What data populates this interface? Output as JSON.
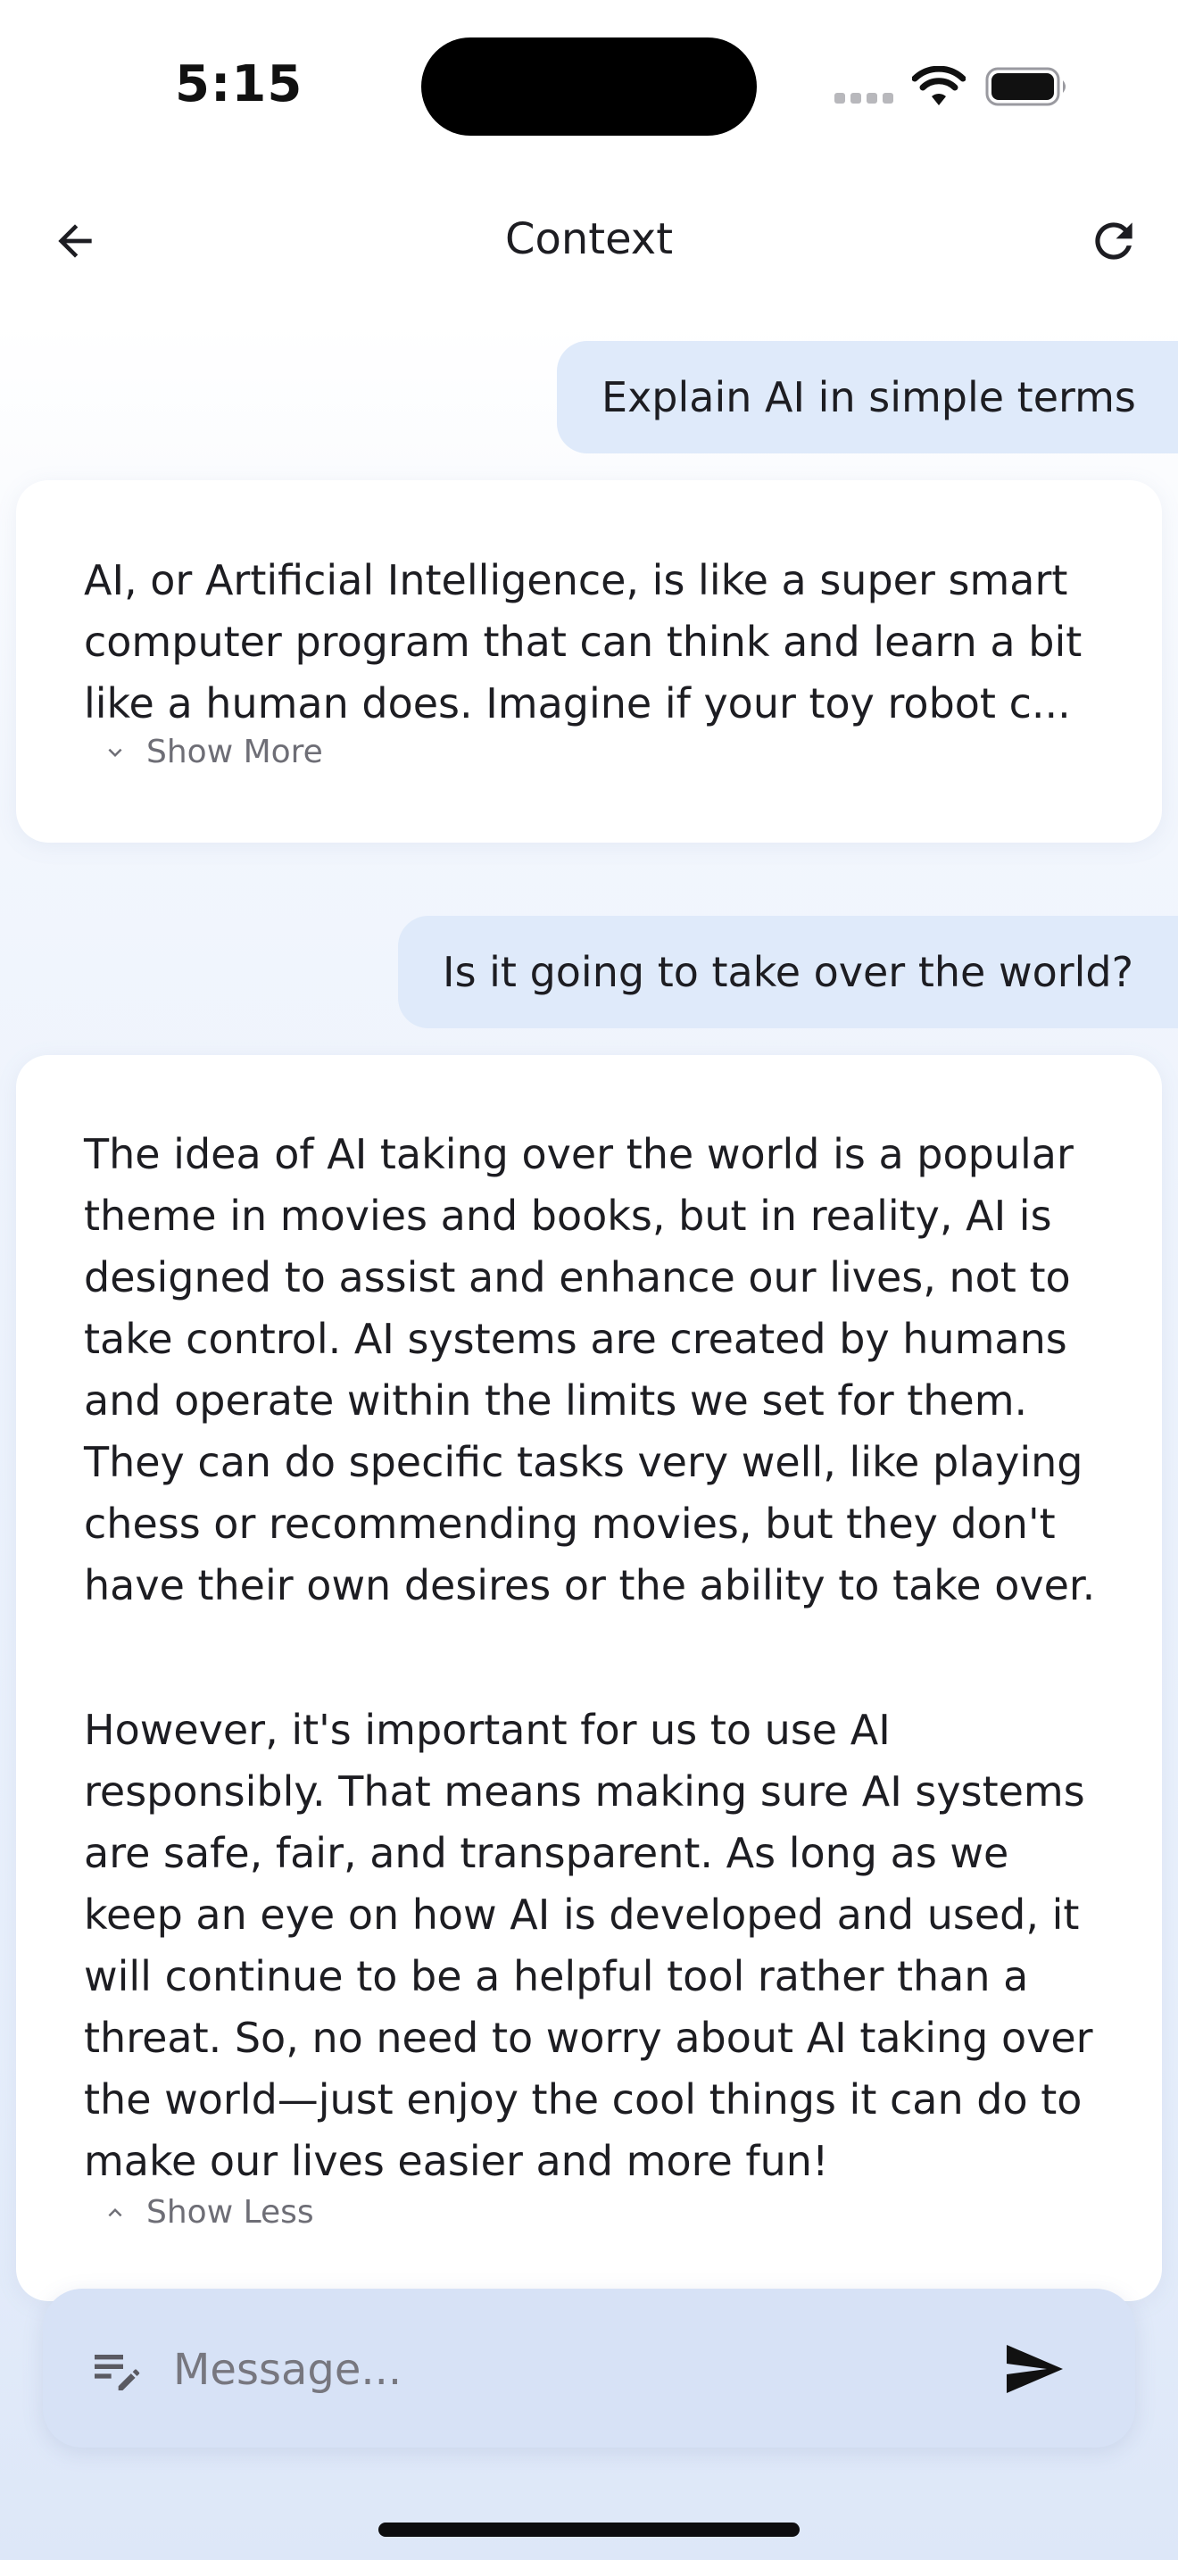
{
  "status_bar": {
    "time": "5:15",
    "icons": [
      "signal-icon",
      "wifi-icon",
      "battery-icon"
    ]
  },
  "header": {
    "title": "Context",
    "back_icon": "arrow-left-icon",
    "refresh_icon": "refresh-icon"
  },
  "messages": [
    {
      "role": "user",
      "text": "Explain AI in simple terms"
    },
    {
      "role": "assistant",
      "text": "AI, or Artificial Intelligence, is like a super smart computer program that can think and learn a bit like a human does. Imagine if your toy robot c...",
      "toggle_label": "Show More",
      "toggle_icon": "chevron-down-icon"
    },
    {
      "role": "user",
      "text": "Is it going to take over the world?"
    },
    {
      "role": "assistant",
      "paragraphs": [
        "The idea of AI taking over the world is a popular theme in movies and books, but in reality, AI is designed to assist and enhance our lives, not to take control. AI systems are created by humans and operate within the limits we set for them. They can do specific tasks very well, like playing chess or recommending movies, but they don't have their own desires or the ability to take over.",
        "However, it's important for us to use AI responsibly. That means making sure AI systems are safe, fair, and transparent. As long as we keep an eye on how AI is developed and used, it will continue to be a helpful tool rather than a threat. So, no need to worry about AI taking over the world—just enjoy the cool things it can do to make our lives easier and more fun!"
      ],
      "toggle_label": "Show Less",
      "toggle_icon": "chevron-up-icon"
    }
  ],
  "composer": {
    "placeholder": "Message...",
    "value": "",
    "leading_icon": "compose-icon",
    "send_icon": "send-icon"
  },
  "colors": {
    "user_bubble": "#dfeafa",
    "composer": "#d7e2f6",
    "card": "#ffffff",
    "muted_text": "#6e6e76"
  }
}
